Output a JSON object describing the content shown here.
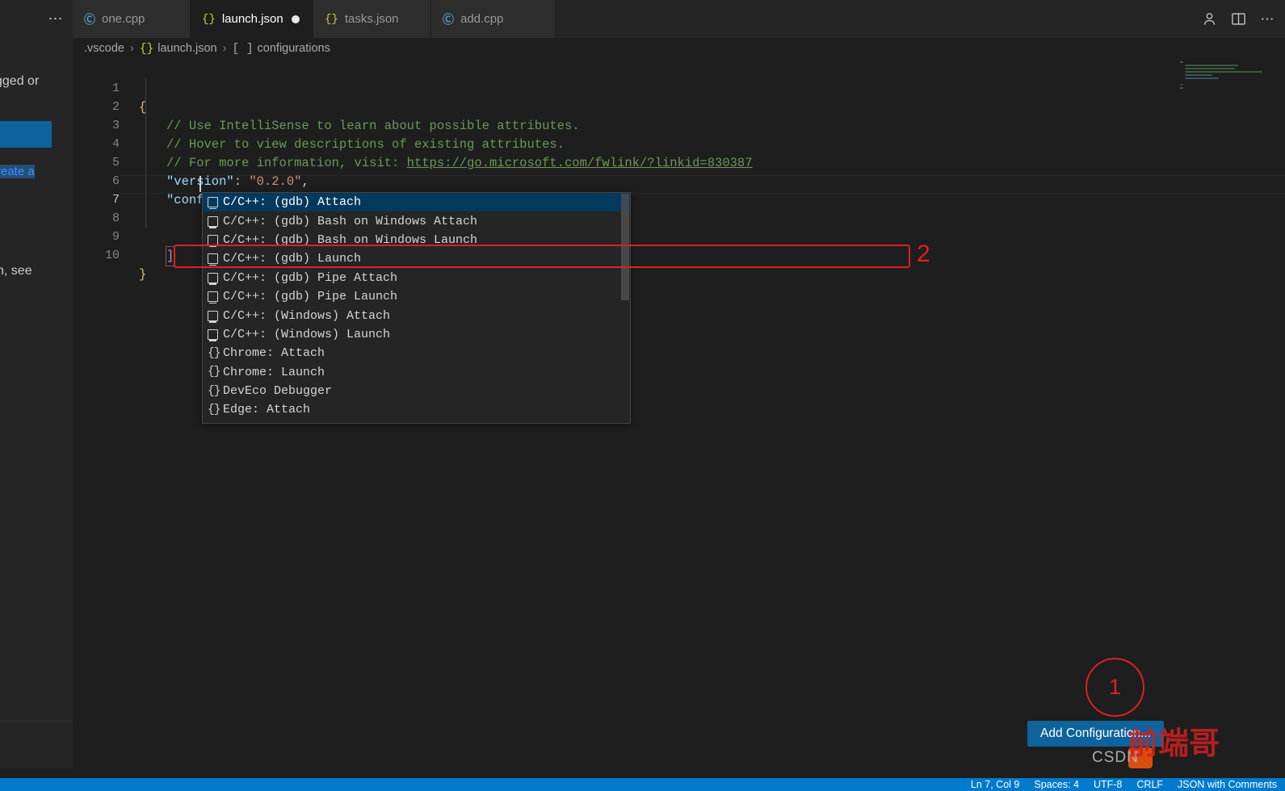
{
  "window": {
    "accent_color": "#0e639c",
    "background": "#1e1e1e",
    "annotation_color": "#e02020"
  },
  "left_panel": {
    "line1": "gged or",
    "link": "reate a",
    "line2": "n, see",
    "line3": "."
  },
  "tabbar": {
    "overflow_label": "⋯",
    "tabs": [
      {
        "label": "one.cpp",
        "icon": "cpp-file-icon",
        "icon_glyph": "Ⓒ",
        "active": false,
        "dirty": false
      },
      {
        "label": "launch.json",
        "icon": "json-file-icon",
        "icon_glyph": "{}",
        "active": true,
        "dirty": true
      },
      {
        "label": "tasks.json",
        "icon": "json-file-icon",
        "icon_glyph": "{}",
        "active": false,
        "dirty": false
      },
      {
        "label": "add.cpp",
        "icon": "cpp-file-icon",
        "icon_glyph": "Ⓒ",
        "active": false,
        "dirty": false
      }
    ],
    "actions": [
      {
        "name": "account-icon",
        "glyph": "⛉"
      },
      {
        "name": "split-editor-icon",
        "glyph": "◫"
      },
      {
        "name": "more-actions-icon",
        "glyph": "⋯"
      }
    ]
  },
  "breadcrumb": {
    "segments": [
      "vscode",
      "launch.json",
      "configurations"
    ],
    "folder": ".vscode",
    "file": "launch.json",
    "symbol": "configurations",
    "file_icon": "{}",
    "symbol_icon": "[ ]",
    "separator": "›"
  },
  "editor": {
    "language": "JSON with Comments",
    "current_line": 7,
    "lines": [
      {
        "n": 1,
        "text": "{"
      },
      {
        "n": 2,
        "text": "    // Use IntelliSense to learn about possible attributes."
      },
      {
        "n": 3,
        "text": "    // Hover to view descriptions of existing attributes."
      },
      {
        "n": 4,
        "text": "    // For more information, visit: https://go.microsoft.com/fwlink/?linkid=830387"
      },
      {
        "n": 5,
        "text": "    \"version\": \"0.2.0\","
      },
      {
        "n": 6,
        "text": "    \"configurations\": ["
      },
      {
        "n": 7,
        "text": "        "
      },
      {
        "n": 8,
        "text": ""
      },
      {
        "n": 9,
        "text": "    ]"
      },
      {
        "n": 10,
        "text": "}"
      }
    ],
    "comment_2": "// Use IntelliSense to learn about possible attributes.",
    "comment_3": "// Hover to view descriptions of existing attributes.",
    "comment_4_prefix": "// For more information, visit: ",
    "comment_4_link": "https://go.microsoft.com/fwlink/?linkid=830387",
    "key_version": "\"version\"",
    "val_version": "\"0.2.0\"",
    "key_configurations": "\"configurations\"",
    "open_bracket": "[",
    "close_bracket": "]",
    "open_brace": "{",
    "close_brace": "}",
    "colon": ": ",
    "comma": ","
  },
  "suggest": {
    "selected_index": 0,
    "items": [
      {
        "label": "C/C++: (gdb) Attach",
        "icon": "property-icon"
      },
      {
        "label": "C/C++: (gdb) Bash on Windows Attach",
        "icon": "property-icon"
      },
      {
        "label": "C/C++: (gdb) Bash on Windows Launch",
        "icon": "property-icon"
      },
      {
        "label": "C/C++: (gdb) Launch",
        "icon": "property-icon"
      },
      {
        "label": "C/C++: (gdb) Pipe Attach",
        "icon": "property-icon"
      },
      {
        "label": "C/C++: (gdb) Pipe Launch",
        "icon": "property-icon"
      },
      {
        "label": "C/C++: (Windows) Attach",
        "icon": "property-icon"
      },
      {
        "label": "C/C++: (Windows) Launch",
        "icon": "property-icon"
      },
      {
        "label": "Chrome: Attach",
        "icon": "snippet-icon",
        "icon_glyph": "{}"
      },
      {
        "label": "Chrome: Launch",
        "icon": "snippet-icon",
        "icon_glyph": "{}"
      },
      {
        "label": "DevEco Debugger",
        "icon": "snippet-icon",
        "icon_glyph": "{}"
      },
      {
        "label": "Edge: Attach",
        "icon": "snippet-icon",
        "icon_glyph": "{}"
      }
    ]
  },
  "annotations": {
    "marker_1": "1",
    "marker_2": "2"
  },
  "add_configuration": {
    "label": "Add Configuration..."
  },
  "statusbar": {
    "items": [
      "Ln 7, Col 9",
      "Spaces: 4",
      "UTF-8",
      "CRLF",
      "JSON with Comments"
    ],
    "position": "Ln 7, Col 9",
    "indentation": "Spaces: 4",
    "encoding": "UTF-8",
    "eol": "CRLF",
    "language_mode": "JSON with Comments"
  },
  "watermark": {
    "text": "CSDN",
    "cn_text": "前端哥"
  }
}
